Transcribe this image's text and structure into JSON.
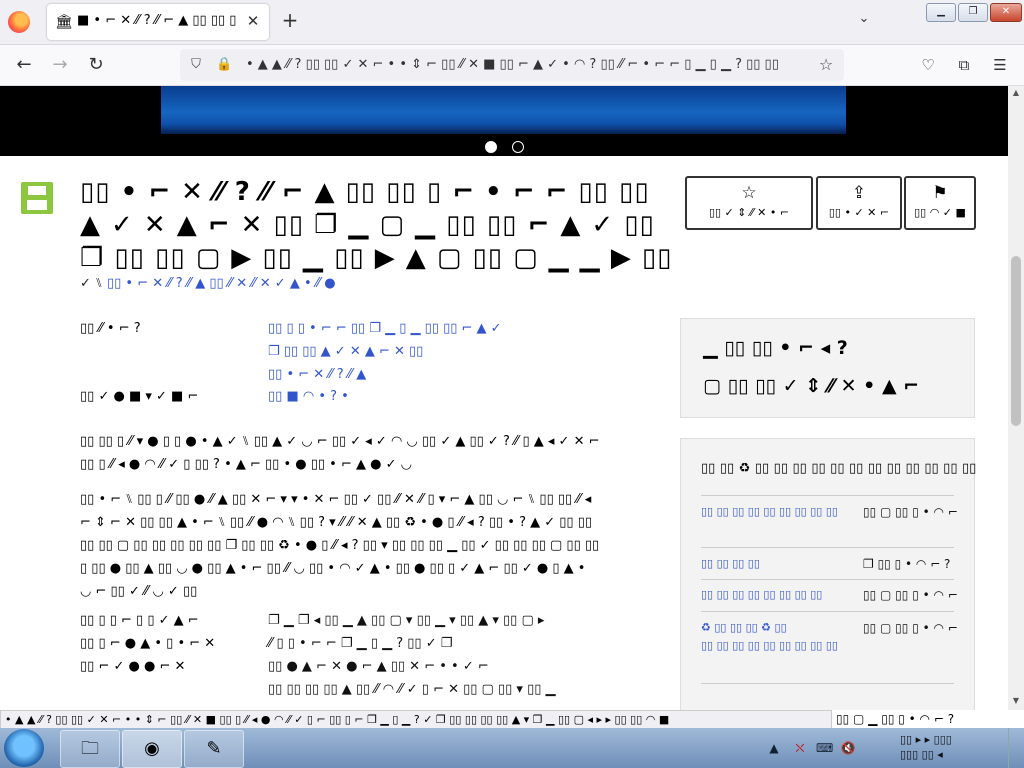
{
  "browser": {
    "tab_title": "■ • ⌐ ✕ ⁄⁄ ? ⁄⁄ ⌐ ▲ ▯▯ ▯▯ ▯▯",
    "tab_favicon": "🏛",
    "tab_close": "✕",
    "new_tab": "+",
    "tab_list": "⌄",
    "window_buttons": {
      "minimize": "▁",
      "restore": "❐",
      "close": "✕"
    },
    "nav": {
      "back": "←",
      "forward": "→",
      "reload": "↻"
    },
    "url_icons": {
      "shield": "⛉",
      "lock": "🔒",
      "star": "☆"
    },
    "url": "• ▲ ▲ ⁄⁄ ? ▯▯ ▯▯ ✓ ✕ ⌐ • • ⇕ ⌐ ▯▯ ⁄⁄ ✕ ■ ▯▯ ⌐ ▲ ✓ • ◠ ? ▯▯ ⁄⁄ ⌐ • ⌐ ⌐ ▯ ▁ ▯ ▁ ? ▯▯ ▯▯",
    "toolbar_icons": {
      "pocket": "♡",
      "extensions": "⧉",
      "menu": "☰"
    }
  },
  "page": {
    "title": "▯▯ • ⌐ ✕ ⁄⁄ ? ⁄⁄ ⌐ ▲ ▯▯ ▯▯ ▯ ⌐ • ⌐ ⌐ ▯▯ ▯▯ ▲ ✓ ✕ ▲ ⌐ ✕ ▯▯ ❐ ▁ ▢ ▁ ▯▯ ▯▯ ⌐ ▲ ✓ ▯▯ ❐ ▯▯ ▯▯ ▢ ▶ ▯▯ ▁ ▯▯ ▶ ▲ ▢ ▯▯ ▢ ▁ ▁ ▶ ▯▯",
    "meta_prefix": "✓ ⑊",
    "meta_link": "▯▯ • ⌐ ✕ ⁄⁄ ? ⁄⁄ ▲ ▯▯ ⁄⁄ ✕ ⁄⁄ ✕ ✓ ▲ • ⁄⁄ ●",
    "actions": [
      {
        "icon": "☆",
        "label": "▯▯ ✓ ⇕ ⁄⁄ ✕ • ⌐"
      },
      {
        "icon": "⇪",
        "label": "▯▯ • ✓ ✕ ⌐"
      },
      {
        "icon": "⚑",
        "label": "▯▯ ◠ ✓ ■"
      }
    ],
    "details": [
      {
        "label": "▯▯ ⁄⁄ • ⌐ ?",
        "value": "▯▯ ▯ ▯ • ⌐ ⌐ ▯▯ ❐ ▁ ▯ ▁ ▯▯ ▯▯ ⌐ ▲ ✓",
        "value2": "❐ ▯▯ ▯▯ ▲ ✓ ✕ ▲ ⌐ ✕ ▯▯",
        "value3": "▯▯ • ⌐ ✕ ⁄⁄ ? ⁄⁄ ▲"
      },
      {
        "label": "▯▯ ✓ ● ■ ▾ ✓ ■ ⌐",
        "value": "▯▯ ■ ◠ • ? •"
      }
    ],
    "paragraph1": "▯▯ ▯▯ ▯ ⁄⁄ ▾ ● ▯ ▯ ● • ▲ ✓ ⑊ ▯▯ ▲ ✓ ◡ ⌐ ▯▯ ✓ ◂ ✓ ◠ ◡ ▯▯ ✓ ▲ ▯▯ ✓ ? ⁄⁄ ▯ ▲ ◂ ✓ ✕ ⌐ ▯▯ ▯ ⁄⁄ ◂ ● ◠ ⁄⁄ ✓ ▯ ▯▯ ? • ▲ ⌐ ▯▯ • ● ▯▯ • ⌐ ▲ ● ✓ ◡",
    "paragraph2": "▯▯ • ⌐ ⑊ ▯▯ ▯ ⁄⁄ ▯▯ ● ⁄⁄ ▲ ▯▯ ✕ ⌐ ▾ ▾ • ✕ ⌐ ▯▯ ✓ ▯▯ ⁄⁄ ✕ ⁄⁄ ▯ ▾ ⌐ ▲ ▯▯ ◡ ⌐ ⑊ ▯▯ ▯▯ ⁄⁄ ◂ ⌐ ⇕ ⌐ ✕ ▯▯ ▯▯ ▲ • ⌐ ⑊ ▯▯ ⁄⁄ ● ◠ ⑊ ▯▯ ? ▾ ⁄⁄ ⁄⁄ ✕ ▲ ▯▯ ♻ • ● ▯ ⁄⁄ ◂ ? ▯▯ • ? ▲ ✓ ▯▯ ▯▯ ▯▯ ▯▯ ▢ ▯▯ ▯▯ ▯▯ ▯▯ ▯▯ ❐ ▯▯ ▯▯ ♻ • ● ▯ ⁄⁄ ◂ ? ▯▯ ▾ ▯▯ ▯▯ ▯▯ ▁ ▯▯ ✓ ▯▯ ▯▯ ▯▯ ▢ ▯▯ ▯▯ ▯ ▯▯ ● ▯▯ ▲ ▯▯ ◡ ● ▯▯ ▲ • ⌐ ▯▯ ⁄⁄ ◡ ▯▯ • ◠ ✓ ▲ • ▯▯ ● ▯▯ ▯ ✓ ▲ ⌐ ▯▯ ✓ ● ▯ ▲ • ◡ ⌐ ▯▯ ✓ ⁄⁄ ◡ ✓ ▯▯",
    "details2": [
      {
        "label": "▯▯ ▯ ▯ ⌐ ▯ ▯ ✓ ▲ ⌐",
        "value": "❐ ▁ ❐ ◂ ▯▯ ▁ ▲ ▯▯ ▢ ▾ ▯▯ ▁ ▾ ▯▯ ▲ ▾ ▯▯ ▢ ▸"
      },
      {
        "label": "▯▯ ▯ ⌐ ● ▲ • ▯ • ⌐ ✕",
        "value": "⁄⁄ ▯ ▯ • ⌐ ⌐ ❐ ▁ ▯ ▁ ? ▯▯ ✓ ❐"
      },
      {
        "label": "▯▯ ⌐ ✓ ● ● ⌐ ✕",
        "value": "▯▯ ● ▲ ⌐ ✕ ● ⌐ ▲ ▯▯ ✕ ⌐ • • ✓ ⌐"
      },
      {
        "label": "",
        "value": "▯▯ ▯▯ ▯▯ ▯▯ ▲ ▯▯ ⁄⁄ ◠ ⁄⁄ ✓ ▯ ⌐ ✕ ▯▯ ▢ ▯▯ ▾ ▯▯ ▁"
      }
    ],
    "side_box": {
      "line1": "▁ ▯▯ ▯▯ • ⌐ ◂ ?",
      "line2": "▢ ▯▯ ▯▯ ✓ ⇕ ⁄⁄ ✕ • ▲ ⌐"
    },
    "side_list": {
      "heading": "▯▯ ▯▯ ♻ ▯▯ ▯▯ ▯▯ ▯▯ ▯▯ ▯▯ ▯▯ ▯▯ ▯▯ ▯▯ ▯▯ ▯▯",
      "items": [
        {
          "name": "▯▯ ▯▯ ▯▯ ▯▯ ▯▯ ▯▯ ▯▯ ▯▯ ▯▯",
          "size": "▯▯ ▢ ▯▯ ▯ • ◠ ⌐"
        },
        {
          "name": "▯▯ ▯▯ ▯▯ ▯▯",
          "size": "❐ ▯▯ ▯ • ◠ ⌐ ?"
        },
        {
          "name": "▯▯ ▯▯ ▯▯ ▯▯ ▯▯ ▯▯ ▯▯ ▯▯",
          "size": "▯▯ ▢ ▯▯ ▯ • ◠ ⌐"
        },
        {
          "name": "♻ ▯▯ ▯▯ ▯▯ ♻ ▯▯",
          "name2": "▯▯ ▯▯ ▯▯ ▯▯ ▯▯ ▯▯ ▯▯ ▯▯ ▯▯",
          "size": "▯▯ ▢ ▯▯ ▯ • ◠ ⌐"
        }
      ]
    },
    "below_status_text": "▯▯ ▢ ▁ ▯▯ ▯ • ◠ ⌐ ?"
  },
  "status_bar": "• ▲ ▲ ⁄⁄ ? ▯▯ ▯▯ ✓ ✕ ⌐ • • ⇕ ⌐ ▯▯ ⁄⁄ ✕ ■ ▯▯ ▯ ⁄⁄ ◂ ● ◠ ⁄⁄ ✓ ▯ ⌐ ▯▯ ▯ ⌐ ❐ ▁ ▯ ▁ ? ✓ ❐ ▯▯ ▯▯ ▯▯ ▯▯ ▲ ▾ ❐ ▁ ▯▯ ▢ ◂ ▸ ▸ ▯▯ ▯▯ ◠ ■",
  "taskbar": {
    "apps": [
      {
        "icon": "🗀"
      },
      {
        "icon": "◉"
      },
      {
        "icon": "✎"
      }
    ],
    "tray": {
      "up": "▲",
      "network_off": "⛌",
      "monitor": "⌨",
      "volume_mute": "🔇"
    },
    "clock_time": "▯▯ ▸ ▸ ▯▯▯",
    "clock_date": "▯▯▯ ▯▯ ◂"
  },
  "colors": {
    "accent_link": "#3355cc",
    "save_icon": "#8dc63f",
    "hero_blue": "#1565c0"
  }
}
